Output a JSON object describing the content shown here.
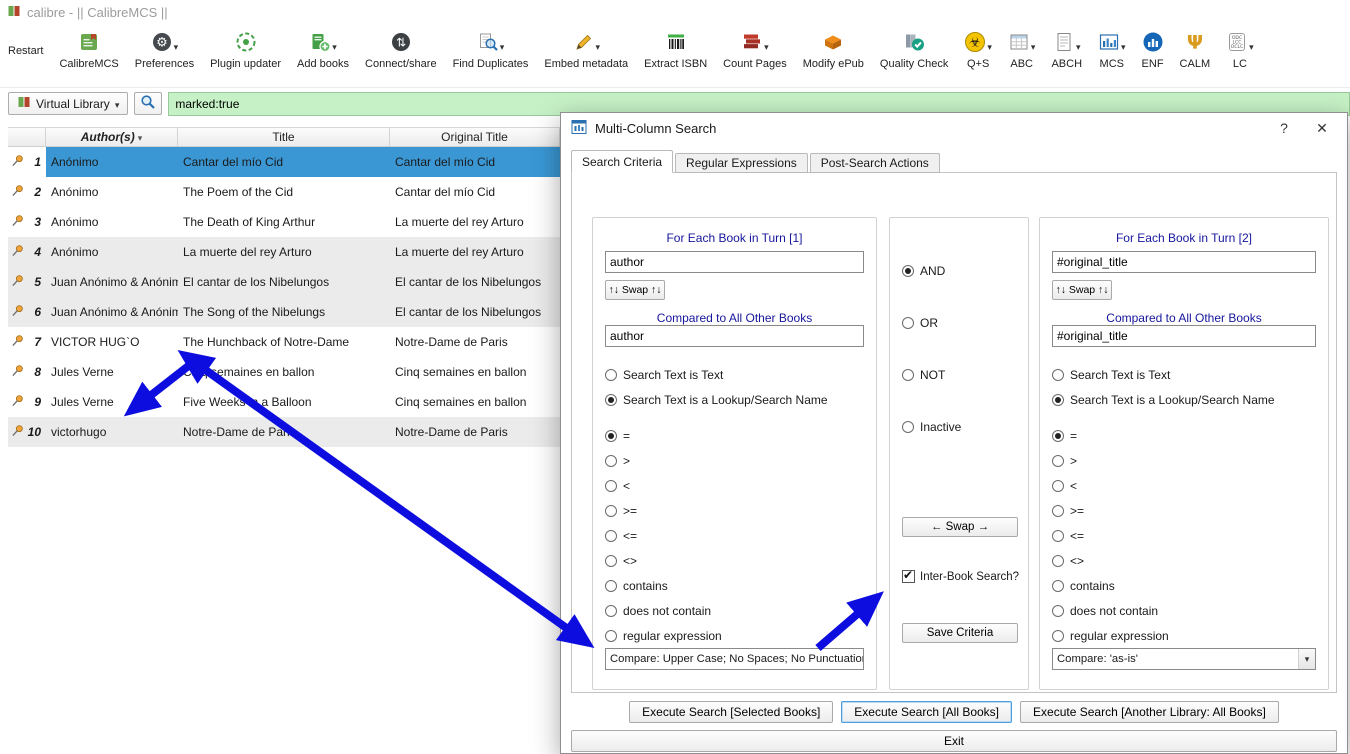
{
  "window": {
    "title": "calibre - || CalibreMCS ||"
  },
  "toolbar": {
    "items": [
      {
        "label": "Restart",
        "icon": "restart-icon"
      },
      {
        "label": "CalibreMCS",
        "icon": "calibre-mcs-icon"
      },
      {
        "label": "Preferences",
        "icon": "preferences-icon",
        "dropdown": true
      },
      {
        "label": "Plugin updater",
        "icon": "plugin-updater-icon"
      },
      {
        "label": "Add books",
        "icon": "add-books-icon",
        "dropdown": true
      },
      {
        "label": "Connect/share",
        "icon": "connect-share-icon"
      },
      {
        "label": "Find Duplicates",
        "icon": "find-duplicates-icon",
        "dropdown": true
      },
      {
        "label": "Embed metadata",
        "icon": "embed-metadata-icon",
        "dropdown": true
      },
      {
        "label": "Extract ISBN",
        "icon": "extract-isbn-icon"
      },
      {
        "label": "Count Pages",
        "icon": "count-pages-icon",
        "dropdown": true
      },
      {
        "label": "Modify ePub",
        "icon": "modify-epub-icon"
      },
      {
        "label": "Quality Check",
        "icon": "quality-check-icon"
      },
      {
        "label": "Q+S",
        "icon": "biohazard-icon",
        "dropdown": true
      },
      {
        "label": "ABC",
        "icon": "spreadsheet-icon",
        "dropdown": true
      },
      {
        "label": "ABCH",
        "icon": "page-icon",
        "dropdown": true
      },
      {
        "label": "MCS",
        "icon": "mcs-chart-icon",
        "dropdown": true
      },
      {
        "label": "ENF",
        "icon": "enf-chart-icon"
      },
      {
        "label": "CALM",
        "icon": "trident-icon"
      },
      {
        "label": "LC",
        "icon": "lc-classification-icon",
        "dropdown": true,
        "icon_lines": [
          "ODC",
          "LCC",
          "OCLC"
        ]
      }
    ]
  },
  "searchbar": {
    "virtual_library": "Virtual Library",
    "query": "marked:true"
  },
  "table": {
    "headers": {
      "authors": "Author(s)",
      "title": "Title",
      "original_title": "Original Title"
    },
    "rows": [
      {
        "num": "1",
        "author": "Anónimo",
        "title": "Cantar del mío Cid",
        "original": "Cantar del mío Cid",
        "selected": true,
        "shaded": false
      },
      {
        "num": "2",
        "author": "Anónimo",
        "title": "The Poem of the Cid",
        "original": "Cantar del mío Cid",
        "selected": false,
        "shaded": false
      },
      {
        "num": "3",
        "author": "Anónimo",
        "title": "The Death of King Arthur",
        "original": "La muerte del rey Arturo",
        "selected": false,
        "shaded": false
      },
      {
        "num": "4",
        "author": "Anónimo",
        "title": "La muerte del rey Arturo",
        "original": "La muerte del rey Arturo",
        "selected": false,
        "shaded": true
      },
      {
        "num": "5",
        "author": "Juan Anónimo & Anónim…",
        "title": "El cantar de los Nibelungos",
        "original": "El cantar de los Nibelungos",
        "selected": false,
        "shaded": true
      },
      {
        "num": "6",
        "author": "Juan Anónimo & Anónim…",
        "title": "The Song of the Nibelungs",
        "original": "El cantar de los Nibelungos",
        "selected": false,
        "shaded": true
      },
      {
        "num": "7",
        "author": "VICTOR HUG`O",
        "title": "The Hunchback of Notre-Dame",
        "original": "Notre-Dame de Paris",
        "selected": false,
        "shaded": false
      },
      {
        "num": "8",
        "author": "Jules Verne",
        "title": "Cinq semaines en ballon",
        "original": "Cinq semaines en ballon",
        "selected": false,
        "shaded": false
      },
      {
        "num": "9",
        "author": "Jules Verne",
        "title": "Five Weeks in a Balloon",
        "original": "Cinq semaines en ballon",
        "selected": false,
        "shaded": false
      },
      {
        "num": "10",
        "author": "victorhugo",
        "title": "Notre-Dame de Paris",
        "original": "Notre-Dame de Paris",
        "selected": false,
        "shaded": true
      }
    ]
  },
  "dialog": {
    "title": "Multi-Column Search",
    "help_label": "?",
    "close_label": "✕",
    "tabs": [
      {
        "label": "Search Criteria",
        "active": true
      },
      {
        "label": "Regular Expressions",
        "active": false
      },
      {
        "label": "Post-Search Actions",
        "active": false
      }
    ],
    "panel1": {
      "heading": "For Each Book in Turn [1]",
      "search_value": "author",
      "swap_label": "↑↓ Swap ↑↓",
      "compare_heading": "Compared to All Other Books",
      "compare_value": "author",
      "text_type_options": [
        {
          "label": "Search Text is Text",
          "checked": false
        },
        {
          "label": "Search Text is a Lookup/Search Name",
          "checked": true
        }
      ],
      "operators": [
        {
          "label": "=",
          "checked": true
        },
        {
          "label": ">",
          "checked": false
        },
        {
          "label": "<",
          "checked": false
        },
        {
          "label": ">=",
          "checked": false
        },
        {
          "label": "<=",
          "checked": false
        },
        {
          "label": "<>",
          "checked": false
        },
        {
          "label": "contains",
          "checked": false
        },
        {
          "label": "does not contain",
          "checked": false
        },
        {
          "label": "regular expression",
          "checked": false
        }
      ],
      "compare_mode": "Compare: Upper Case; No Spaces; No Punctuation"
    },
    "combine": {
      "options": [
        {
          "label": "AND",
          "checked": true
        },
        {
          "label": "OR",
          "checked": false
        },
        {
          "label": "NOT",
          "checked": false
        },
        {
          "label": "Inactive",
          "checked": false
        }
      ],
      "swap_label": "← Swap →",
      "inter_book_label": "Inter-Book Search?",
      "inter_book_checked": true,
      "save_label": "Save Criteria"
    },
    "panel2": {
      "heading": "For Each Book in Turn [2]",
      "search_value": "#original_title",
      "swap_label": "↑↓ Swap ↑↓",
      "compare_heading": "Compared to All Other Books",
      "compare_value": "#original_title",
      "text_type_options": [
        {
          "label": "Search Text is Text",
          "checked": false
        },
        {
          "label": "Search Text is a Lookup/Search Name",
          "checked": true
        }
      ],
      "operators": [
        {
          "label": "=",
          "checked": true
        },
        {
          "label": ">",
          "checked": false
        },
        {
          "label": "<",
          "checked": false
        },
        {
          "label": ">=",
          "checked": false
        },
        {
          "label": "<=",
          "checked": false
        },
        {
          "label": "<>",
          "checked": false
        },
        {
          "label": "contains",
          "checked": false
        },
        {
          "label": "does not contain",
          "checked": false
        },
        {
          "label": "regular expression",
          "checked": false
        }
      ],
      "compare_mode": "Compare: 'as-is'"
    },
    "footer": {
      "execute_selected": "Execute Search [Selected Books]",
      "execute_all": "Execute Search [All Books]",
      "execute_other": "Execute Search [Another Library: All Books]",
      "exit": "Exit"
    }
  },
  "colors": {
    "selection_blue": "#3a97d4",
    "search_green": "#c6f1c6",
    "arrow_blue": "#0d0de0",
    "heading_blue": "#16169c",
    "pin_orange": "#f2a43c"
  }
}
